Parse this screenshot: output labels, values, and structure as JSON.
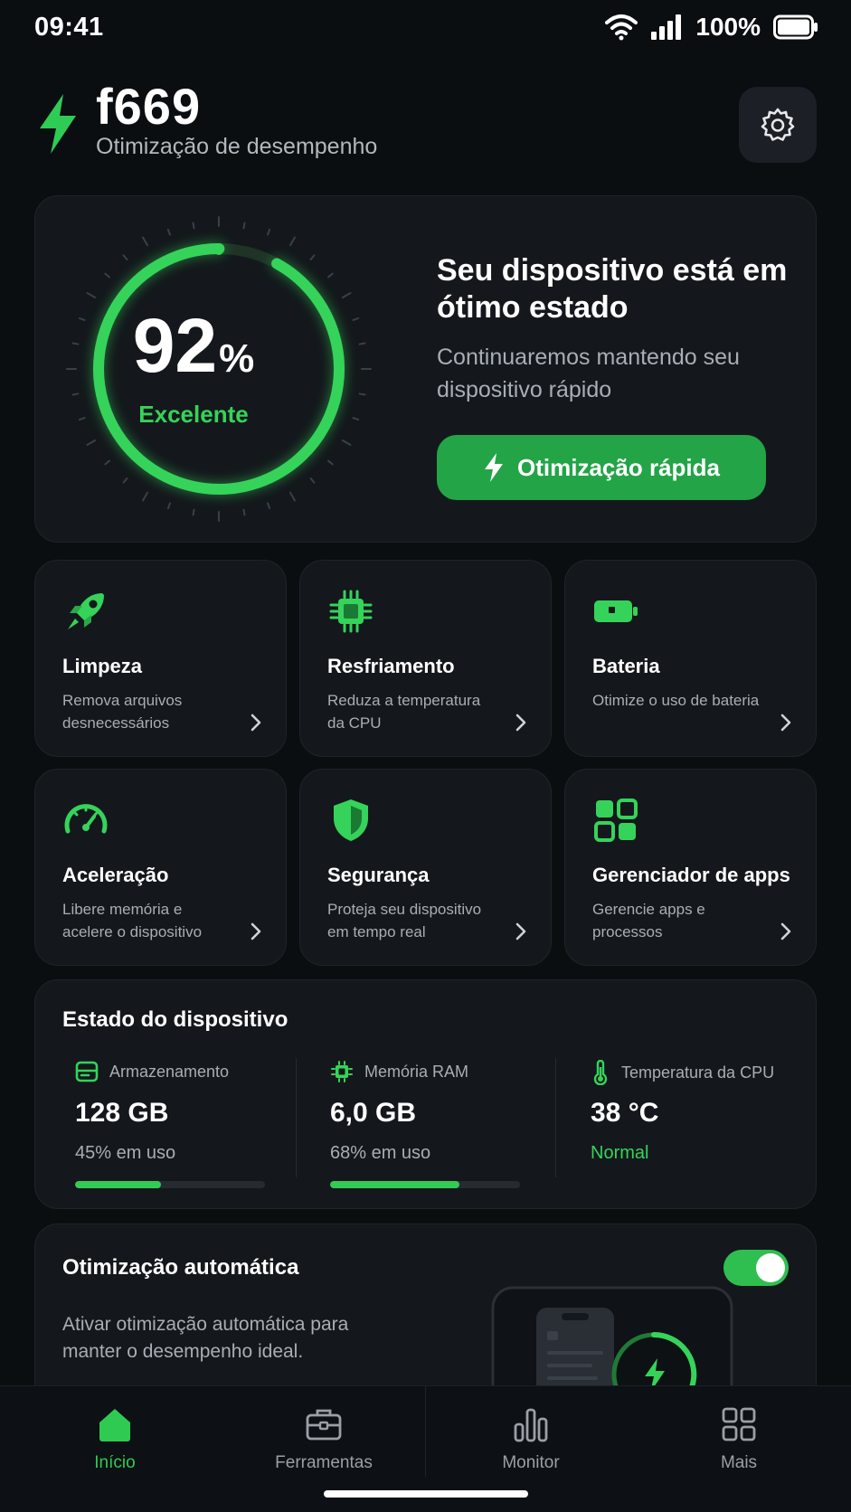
{
  "status_bar": {
    "time": "09:41",
    "battery": "100%"
  },
  "header": {
    "app_name": "f669",
    "subtitle": "Otimização de desempenho",
    "settings_icon": "gear-icon"
  },
  "hero": {
    "score": "92",
    "score_unit": "%",
    "score_fraction": 0.92,
    "score_label": "Excelente",
    "title": "Seu dispositivo está em ótimo estado",
    "description": "Continuaremos mantendo seu dispositivo rápido",
    "button_label": "Otimização rápida"
  },
  "tools": [
    {
      "title": "Limpeza",
      "description": "Remova arquivos desnecessários",
      "icon": "rocket-icon"
    },
    {
      "title": "Resfriamento",
      "description": "Reduza a temperatura da CPU",
      "icon": "cpu-icon"
    },
    {
      "title": "Bateria",
      "description": "Otimize o uso de bateria",
      "icon": "battery-icon"
    },
    {
      "title": "Aceleração",
      "description": "Libere memória e acelere o dispositivo",
      "icon": "speedometer-icon"
    },
    {
      "title": "Segurança",
      "description": "Proteja seu dispositivo em tempo real",
      "icon": "shield-icon"
    },
    {
      "title": "Gerenciador de apps",
      "description": "Gerencie apps e processos",
      "icon": "apps-grid-icon"
    }
  ],
  "device_status": {
    "title": "Estado do dispositivo",
    "storage": {
      "label": "Armazenamento",
      "value": "128 GB",
      "usage": "45% em uso",
      "fraction": 0.45
    },
    "ram": {
      "label": "Memória RAM",
      "value": "6,0 GB",
      "usage": "68% em uso",
      "fraction": 0.68
    },
    "cpu_temp": {
      "label": "Temperatura da CPU",
      "value": "38 °C",
      "status": "Normal"
    }
  },
  "auto_optimization": {
    "title": "Otimização automática",
    "description": "Ativar otimização automática para manter o desempenho ideal.",
    "enabled": true
  },
  "bottom_nav": [
    {
      "label": "Início",
      "icon": "home-icon",
      "active": true
    },
    {
      "label": "Ferramentas",
      "icon": "toolbox-icon",
      "active": false
    },
    {
      "label": "Monitor",
      "icon": "bar-chart-icon",
      "active": false
    },
    {
      "label": "Mais",
      "icon": "grid-icon",
      "active": false
    }
  ],
  "colors": {
    "accent": "#32cc55",
    "background": "#0b0e11",
    "card": "#14181c"
  }
}
